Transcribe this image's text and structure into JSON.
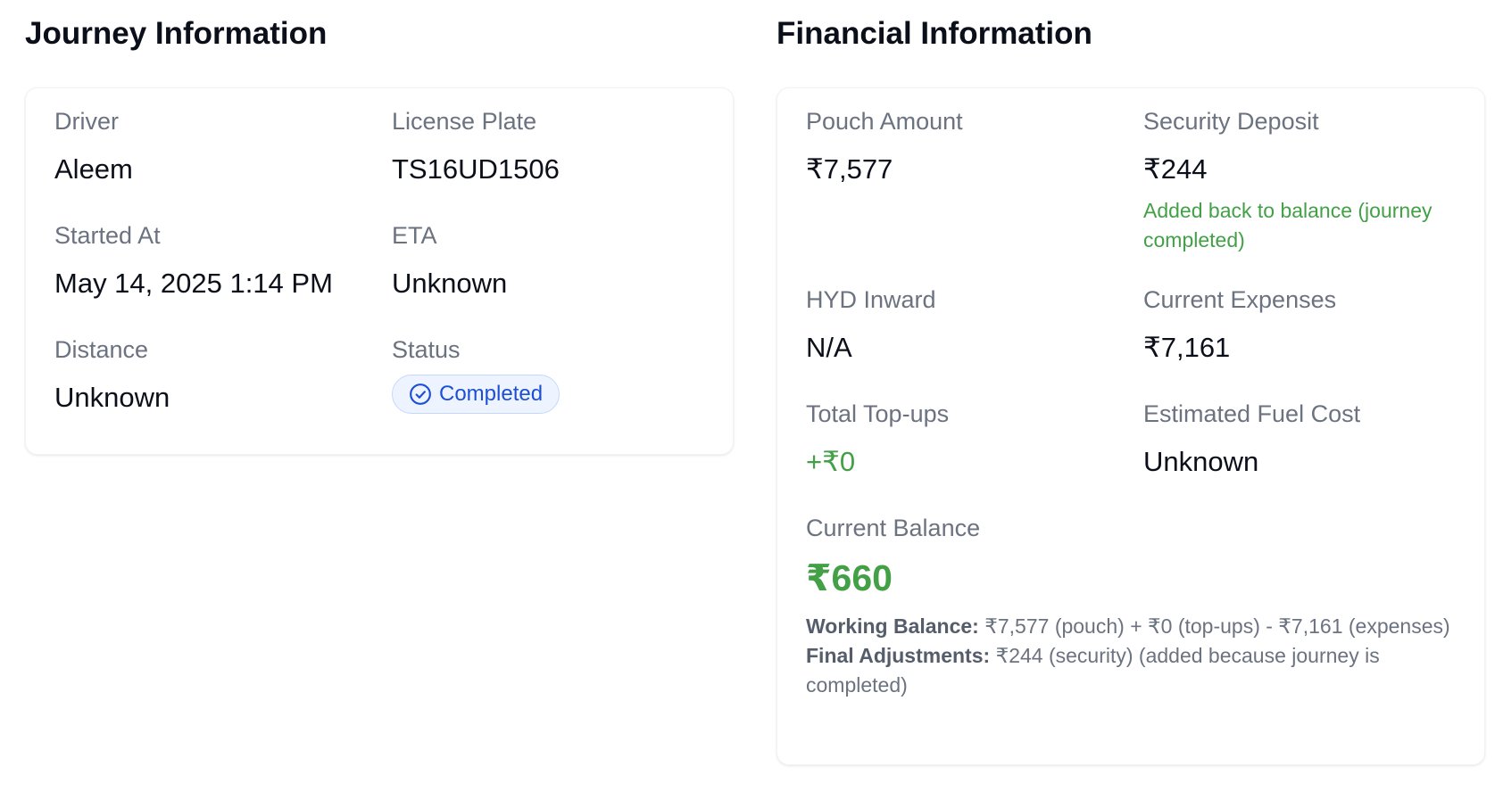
{
  "journey": {
    "title": "Journey Information",
    "driver_label": "Driver",
    "driver_value": "Aleem",
    "plate_label": "License Plate",
    "plate_value": "TS16UD1506",
    "started_label": "Started At",
    "started_value": "May 14, 2025 1:14 PM",
    "eta_label": "ETA",
    "eta_value": "Unknown",
    "distance_label": "Distance",
    "distance_value": "Unknown",
    "status_label": "Status",
    "status_value": "Completed",
    "status_icon": "check-circle-icon",
    "status_color": "#1d4ed8"
  },
  "finance": {
    "title": "Financial Information",
    "pouch_label": "Pouch Amount",
    "pouch_value": "₹7,577",
    "security_label": "Security Deposit",
    "security_value": "₹244",
    "security_note": "Added back to balance (journey completed)",
    "hyd_label": "HYD Inward",
    "hyd_value": "N/A",
    "expenses_label": "Current Expenses",
    "expenses_value": "₹7,161",
    "topups_label": "Total Top-ups",
    "topups_value": "+₹0",
    "fuel_label": "Estimated Fuel Cost",
    "fuel_value": "Unknown",
    "balance_label": "Current Balance",
    "balance_value": "₹660",
    "working_label": "Working Balance:",
    "working_text": "₹7,577 (pouch) + ₹0 (top-ups) - ₹7,161 (expenses)",
    "final_label": "Final Adjustments:",
    "final_text": "₹244 (security) (added because journey is completed)",
    "positive_color": "#43a047"
  }
}
